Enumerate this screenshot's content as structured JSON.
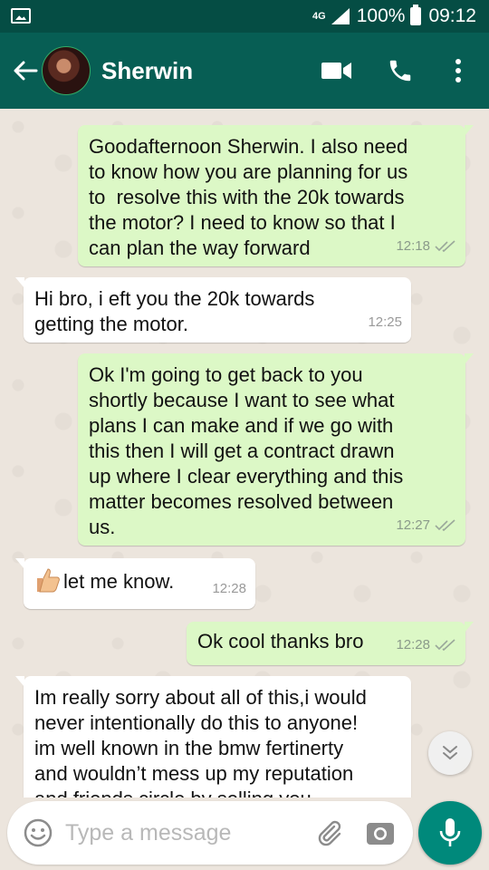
{
  "status_bar": {
    "network": "4G",
    "battery": "100%",
    "time": "09:12"
  },
  "header": {
    "contact_name": "Sherwin"
  },
  "messages": [
    {
      "direction": "out",
      "text": "Goodafternoon Sherwin. I also need\nto know how you are planning for us\nto  resolve this with the 20k towards\nthe motor? I need to know so that I\ncan plan the way forward",
      "time": "12:18",
      "read": true
    },
    {
      "direction": "in",
      "text": "Hi bro, i eft you the 20k towards\ngetting the motor.",
      "time": "12:25"
    },
    {
      "direction": "out",
      "text": "Ok I'm going to get back to you\nshortly because I want to see what\nplans I can make and if we go with\nthis then I will get a contract drawn\nup where I clear everything and this\nmatter becomes resolved between\nus.",
      "time": "12:27",
      "read": true
    },
    {
      "direction": "in",
      "text": "let me know.",
      "time": "12:28",
      "emoji": "thumbs-up"
    },
    {
      "direction": "out",
      "text": "Ok cool thanks bro",
      "time": "12:28",
      "read": true
    },
    {
      "direction": "in",
      "text": "Im really sorry about all of this,i would\nnever intentionally do this to anyone!\nim well known in the bmw fertinerty\nand wouldn’t mess up my reputation\nand friends circle by selling you",
      "time": ""
    }
  ],
  "input": {
    "placeholder": "Type a message"
  },
  "colors": {
    "header": "#075e54",
    "status_bar": "#054d44",
    "outgoing_bubble": "#dcf8c6",
    "incoming_bubble": "#ffffff",
    "read_ticks": "#9aa89a",
    "mic_button": "#00897b"
  },
  "icons": {
    "back": "arrow-left-icon",
    "video": "video-camera-icon",
    "call": "phone-icon",
    "menu": "more-vert-icon",
    "emoji": "smiley-icon",
    "attach": "paperclip-icon",
    "camera": "camera-icon",
    "mic": "microphone-icon",
    "scroll_down": "double-chevron-down-icon"
  }
}
